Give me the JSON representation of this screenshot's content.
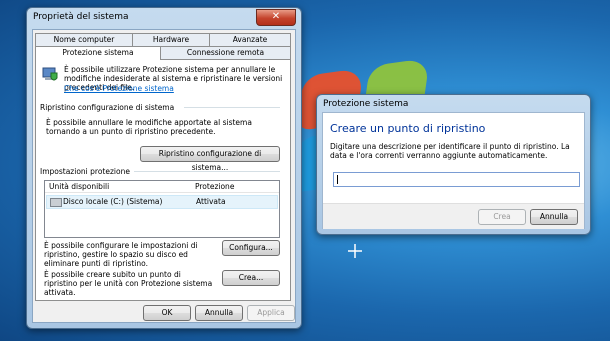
{
  "sysprops": {
    "title": "Proprietà del sistema",
    "close": "✕",
    "tabs_row1": [
      "Nome computer",
      "Hardware",
      "Avanzate"
    ],
    "tabs_row2": [
      "Protezione sistema",
      "Connessione remota"
    ],
    "intro": "È possibile utilizzare Protezione sistema per annullare le modifiche indesiderate al sistema e ripristinare le versioni precedenti dei file.",
    "intro_link": "Che cos'è Protezione sistema",
    "restore_group": "Ripristino configurazione di sistema",
    "restore_text": "È possibile annullare le modifiche apportate al sistema tornando a un punto di ripristino precedente.",
    "restore_button": "Ripristino configurazione di sistema...",
    "settings_group": "Impostazioni protezione",
    "col_drives": "Unità disponibili",
    "col_protection": "Protezione",
    "drive_name": "Disco locale (C:) (Sistema)",
    "drive_status": "Attivata",
    "config_text": "È possibile configurare le impostazioni di ripristino, gestire lo spazio su disco ed eliminare punti di ripristino.",
    "config_button": "Configura...",
    "create_text": "È possibile creare subito un punto di ripristino per le unità con Protezione sistema attivata.",
    "create_button": "Crea...",
    "ok": "OK",
    "cancel": "Annulla",
    "apply": "Applica"
  },
  "dialog": {
    "title": "Protezione sistema",
    "heading": "Creare un punto di ripristino",
    "description": "Digitare una descrizione per identificare il punto di ripristino. La data e l'ora correnti verranno aggiunte automaticamente.",
    "input_value": "",
    "create": "Crea",
    "cancel": "Annulla"
  }
}
